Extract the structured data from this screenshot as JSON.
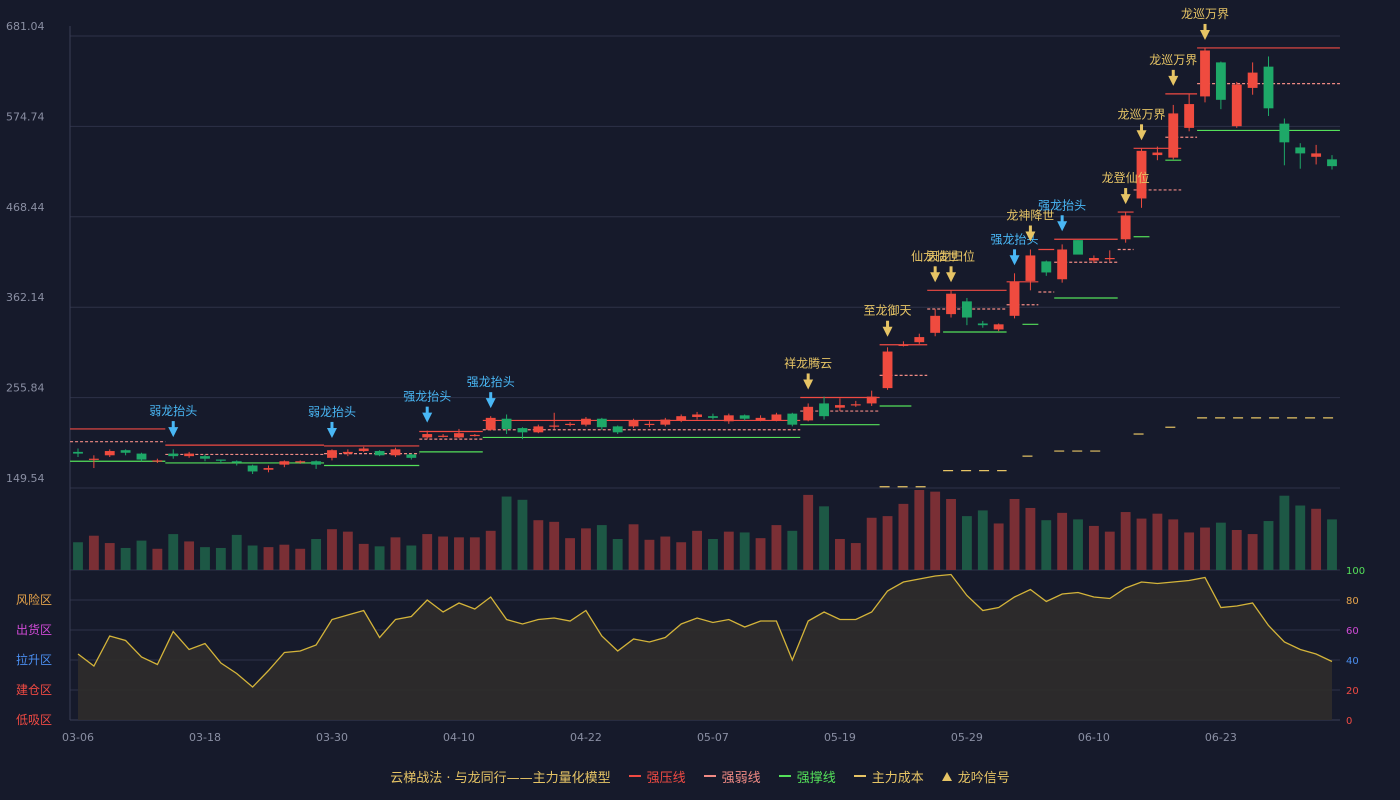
{
  "chart_data": {
    "type": "candlestick",
    "price_axis": {
      "ticks": [
        149.54,
        255.84,
        362.14,
        468.44,
        574.74,
        681.04
      ],
      "labels": [
        "149.54",
        "255.84",
        "362.14",
        "468.44",
        "574.74",
        "681.04"
      ]
    },
    "date_labels": [
      {
        "i": 0,
        "label": "03-06"
      },
      {
        "i": 8,
        "label": "03-18"
      },
      {
        "i": 16,
        "label": "03-30"
      },
      {
        "i": 24,
        "label": "04-10"
      },
      {
        "i": 32,
        "label": "04-22"
      },
      {
        "i": 40,
        "label": "05-07"
      },
      {
        "i": 48,
        "label": "05-19"
      },
      {
        "i": 56,
        "label": "05-29"
      },
      {
        "i": 64,
        "label": "06-10"
      },
      {
        "i": 72,
        "label": "06-23"
      }
    ],
    "candles": [
      [
        192,
        190,
        196,
        186
      ],
      [
        183,
        184,
        188,
        173
      ],
      [
        188,
        193,
        195,
        186
      ],
      [
        194,
        191,
        195,
        188
      ],
      [
        190,
        183,
        191,
        181
      ],
      [
        182,
        182,
        184,
        179
      ],
      [
        190,
        187,
        195,
        184
      ],
      [
        187,
        190,
        192,
        185
      ],
      [
        187,
        184,
        189,
        181
      ],
      [
        183,
        182,
        183,
        178
      ],
      [
        181,
        180,
        182,
        176
      ],
      [
        176,
        169,
        177,
        166
      ],
      [
        171,
        173,
        176,
        168
      ],
      [
        177,
        181,
        182,
        174
      ],
      [
        181,
        181,
        182,
        178
      ],
      [
        181,
        177,
        182,
        172
      ],
      [
        185,
        194,
        195,
        182
      ],
      [
        190,
        192,
        195,
        187
      ],
      [
        193,
        196,
        198,
        192
      ],
      [
        193,
        188,
        194,
        187
      ],
      [
        188,
        195,
        197,
        186
      ],
      [
        189,
        185,
        190,
        183
      ],
      [
        209,
        213,
        217,
        207
      ],
      [
        211,
        211,
        213,
        209
      ],
      [
        209,
        214,
        219,
        208
      ],
      [
        212,
        212,
        213,
        210
      ],
      [
        218,
        232,
        234,
        217
      ],
      [
        231,
        219,
        236,
        213
      ],
      [
        220,
        215,
        221,
        207
      ],
      [
        215,
        222,
        224,
        214
      ],
      [
        223,
        223,
        238,
        219
      ],
      [
        224,
        225,
        227,
        222
      ],
      [
        224,
        231,
        233,
        222
      ],
      [
        231,
        221,
        232,
        218
      ],
      [
        222,
        215,
        223,
        213
      ],
      [
        222,
        229,
        231,
        220
      ],
      [
        224,
        225,
        228,
        221
      ],
      [
        224,
        230,
        232,
        222
      ],
      [
        229,
        234,
        236,
        227
      ],
      [
        233,
        236,
        239,
        230
      ],
      [
        234,
        232,
        237,
        230
      ],
      [
        228,
        235,
        237,
        225
      ],
      [
        235,
        231,
        236,
        229
      ],
      [
        229,
        232,
        235,
        228
      ],
      [
        229,
        236,
        238,
        228
      ],
      [
        237,
        224,
        238,
        222
      ],
      [
        229,
        245,
        249,
        228
      ],
      [
        249,
        234,
        257,
        230
      ],
      [
        244,
        247,
        255,
        240
      ],
      [
        248,
        248,
        252,
        245
      ],
      [
        249,
        257,
        264,
        246
      ],
      [
        267,
        310,
        315,
        265
      ],
      [
        318,
        318,
        322,
        316
      ],
      [
        321,
        327,
        331,
        319
      ],
      [
        332,
        352,
        360,
        328
      ],
      [
        354,
        378,
        382,
        350
      ],
      [
        369,
        350,
        373,
        341
      ],
      [
        343,
        341,
        346,
        338
      ],
      [
        336,
        342,
        343,
        334
      ],
      [
        352,
        392,
        402,
        349
      ],
      [
        393,
        423,
        430,
        382
      ],
      [
        416,
        403,
        417,
        399
      ],
      [
        395,
        430,
        436,
        391
      ],
      [
        441,
        424,
        441,
        425
      ],
      [
        417,
        420,
        423,
        414
      ],
      [
        419,
        420,
        429,
        416
      ],
      [
        442,
        470,
        474,
        438
      ],
      [
        490,
        546,
        549,
        479
      ],
      [
        541,
        544,
        551,
        535
      ],
      [
        538,
        590,
        600,
        536
      ],
      [
        573,
        601,
        613,
        569
      ],
      [
        610,
        664,
        667,
        603
      ],
      [
        650,
        606,
        651,
        595
      ],
      [
        575,
        624,
        627,
        573
      ],
      [
        620,
        638,
        650,
        612
      ],
      [
        645,
        596,
        657,
        587
      ],
      [
        578,
        556,
        584,
        529
      ],
      [
        550,
        543,
        555,
        525
      ],
      [
        539,
        543,
        553,
        530
      ],
      [
        536,
        528,
        541,
        524
      ]
    ],
    "volume": [
      34,
      42,
      33,
      27,
      36,
      26,
      44,
      35,
      28,
      27,
      43,
      30,
      28,
      31,
      26,
      38,
      50,
      47,
      32,
      29,
      40,
      30,
      44,
      41,
      40,
      40,
      48,
      90,
      86,
      61,
      59,
      39,
      51,
      55,
      38,
      56,
      37,
      41,
      34,
      48,
      38,
      47,
      46,
      39,
      55,
      48,
      92,
      78,
      38,
      33,
      64,
      66,
      81,
      98,
      96,
      87,
      66,
      73,
      57,
      87,
      76,
      61,
      70,
      62,
      54,
      47,
      71,
      63,
      69,
      62,
      46,
      52,
      58,
      49,
      44,
      60,
      91,
      79,
      75,
      62
    ],
    "indicator": [
      44,
      36,
      56,
      53,
      42,
      37,
      59,
      47,
      51,
      38,
      31,
      22,
      33,
      45,
      46,
      50,
      67,
      70,
      73,
      55,
      67,
      69,
      80,
      72,
      78,
      74,
      82,
      67,
      64,
      67,
      68,
      66,
      73,
      56,
      46,
      54,
      52,
      55,
      64,
      68,
      65,
      67,
      62,
      66,
      66,
      40,
      66,
      72,
      67,
      67,
      72,
      86,
      92,
      94,
      96,
      97,
      83,
      73,
      75,
      82,
      87,
      79,
      84,
      85,
      82,
      81,
      88,
      92,
      91,
      92,
      93,
      95,
      75,
      76,
      78,
      63,
      52,
      47,
      44,
      39
    ],
    "indicator_axis": {
      "ticks": [
        0,
        20,
        40,
        60,
        80,
        100
      ],
      "labels": [
        "0",
        "20",
        "40",
        "60",
        "80",
        "100"
      ]
    },
    "zones": [
      "风险区",
      "出货区",
      "拉升区",
      "建仓区",
      "低吸区"
    ],
    "zone_colors": [
      "#e6a34a",
      "#d04ad6",
      "#4a8ef0",
      "#f04a43",
      "#f04a43"
    ],
    "indicator_axis_colors": [
      "#f04a43",
      "#f04a43",
      "#4a8ef0",
      "#d04ad6",
      "#e6a34a",
      "#54e05a"
    ],
    "signals": [
      {
        "i": 6,
        "label": "弱龙抬头",
        "kind": "blue"
      },
      {
        "i": 16,
        "label": "弱龙抬头",
        "kind": "blue"
      },
      {
        "i": 22,
        "label": "强龙抬头",
        "kind": "blue"
      },
      {
        "i": 26,
        "label": "强龙抬头",
        "kind": "blue"
      },
      {
        "i": 46,
        "label": "祥龙腾云",
        "kind": "gold"
      },
      {
        "i": 51,
        "label": "至龙御天",
        "kind": "gold"
      },
      {
        "i": 54,
        "label": "仙龙临世",
        "kind": "gold"
      },
      {
        "i": 55,
        "label": "天龙归位",
        "kind": "gold"
      },
      {
        "i": 59,
        "label": "强龙抬头",
        "kind": "blue"
      },
      {
        "i": 60,
        "label": "龙神降世",
        "kind": "gold"
      },
      {
        "i": 62,
        "label": "强龙抬头",
        "kind": "blue"
      },
      {
        "i": 66,
        "label": "龙登仙位",
        "kind": "gold"
      },
      {
        "i": 67,
        "label": "龙巡万界",
        "kind": "gold"
      },
      {
        "i": 69,
        "label": "龙巡万界",
        "kind": "gold"
      },
      {
        "i": 71,
        "label": "龙巡万界",
        "kind": "gold"
      }
    ],
    "resistance_lines": [
      {
        "from": 0,
        "to": 5,
        "value": 219
      },
      {
        "from": 6,
        "to": 15,
        "value": 200
      },
      {
        "from": 16,
        "to": 21,
        "value": 199
      },
      {
        "from": 22,
        "to": 25,
        "value": 216
      },
      {
        "from": 26,
        "to": 45,
        "value": 229
      },
      {
        "from": 46,
        "to": 50,
        "value": 256
      },
      {
        "from": 51,
        "to": 53,
        "value": 318
      },
      {
        "from": 54,
        "to": 58,
        "value": 382
      },
      {
        "from": 59,
        "to": 60,
        "value": 392
      },
      {
        "from": 61,
        "to": 61,
        "value": 430
      },
      {
        "from": 62,
        "to": 65,
        "value": 442
      },
      {
        "from": 66,
        "to": 66,
        "value": 474
      },
      {
        "from": 67,
        "to": 69,
        "value": 549
      },
      {
        "from": 69,
        "to": 70,
        "value": 613
      },
      {
        "from": 71,
        "to": 79,
        "value": 667
      }
    ],
    "weak_lines": [
      {
        "from": 0,
        "to": 5,
        "value": 204
      },
      {
        "from": 6,
        "to": 15,
        "value": 189
      },
      {
        "from": 16,
        "to": 21,
        "value": 190
      },
      {
        "from": 22,
        "to": 25,
        "value": 207
      },
      {
        "from": 26,
        "to": 45,
        "value": 218
      },
      {
        "from": 46,
        "to": 50,
        "value": 240
      },
      {
        "from": 51,
        "to": 53,
        "value": 282
      },
      {
        "from": 54,
        "to": 58,
        "value": 360
      },
      {
        "from": 59,
        "to": 60,
        "value": 365
      },
      {
        "from": 61,
        "to": 61,
        "value": 380
      },
      {
        "from": 62,
        "to": 65,
        "value": 415
      },
      {
        "from": 66,
        "to": 66,
        "value": 430
      },
      {
        "from": 67,
        "to": 69,
        "value": 500
      },
      {
        "from": 69,
        "to": 70,
        "value": 562
      },
      {
        "from": 71,
        "to": 79,
        "value": 625
      }
    ],
    "support_lines": [
      {
        "from": 0,
        "to": 5,
        "value": 181
      },
      {
        "from": 6,
        "to": 15,
        "value": 179
      },
      {
        "from": 16,
        "to": 21,
        "value": 176
      },
      {
        "from": 22,
        "to": 25,
        "value": 192
      },
      {
        "from": 26,
        "to": 45,
        "value": 209
      },
      {
        "from": 46,
        "to": 50,
        "value": 224
      },
      {
        "from": 51,
        "to": 52,
        "value": 246
      },
      {
        "from": 55,
        "to": 58,
        "value": 333
      },
      {
        "from": 60,
        "to": 60,
        "value": 342
      },
      {
        "from": 62,
        "to": 65,
        "value": 373
      },
      {
        "from": 67,
        "to": 67,
        "value": 445
      },
      {
        "from": 69,
        "to": 69,
        "value": 535
      },
      {
        "from": 71,
        "to": 79,
        "value": 570
      }
    ],
    "cost_lines": [
      {
        "from": 51,
        "to": 53,
        "value": 151
      },
      {
        "from": 55,
        "to": 58,
        "value": 170
      },
      {
        "from": 60,
        "to": 60,
        "value": 187
      },
      {
        "from": 62,
        "to": 64,
        "value": 193
      },
      {
        "from": 67,
        "to": 67,
        "value": 213
      },
      {
        "from": 69,
        "to": 69,
        "value": 221
      },
      {
        "from": 71,
        "to": 79,
        "value": 232
      }
    ]
  },
  "legend": {
    "title": "云梯战法 · 与龙同行——主力量化模型",
    "items": [
      {
        "label": "强压线",
        "style": "solid-red"
      },
      {
        "label": "强弱线",
        "style": "dash-red"
      },
      {
        "label": "强撑线",
        "style": "solid-green"
      },
      {
        "label": "主力成本",
        "style": "dash-gold"
      },
      {
        "label": "龙吟信号",
        "style": "triangle"
      }
    ]
  },
  "colors": {
    "up": "#ef4b3f",
    "down": "#1ea868",
    "grid": "#2e3248",
    "axis_text": "#8a8fa3",
    "resistance": "#f04a43",
    "weak": "#f08a84",
    "support": "#54e05a",
    "cost": "#e6c465",
    "signal_gold": "#e6c465",
    "signal_blue": "#49b7f5",
    "vol_up": "#7a2f35",
    "vol_down": "#1d5845",
    "indicator_line": "#d4b43a",
    "indicator_fill": "#2f2c2b"
  }
}
